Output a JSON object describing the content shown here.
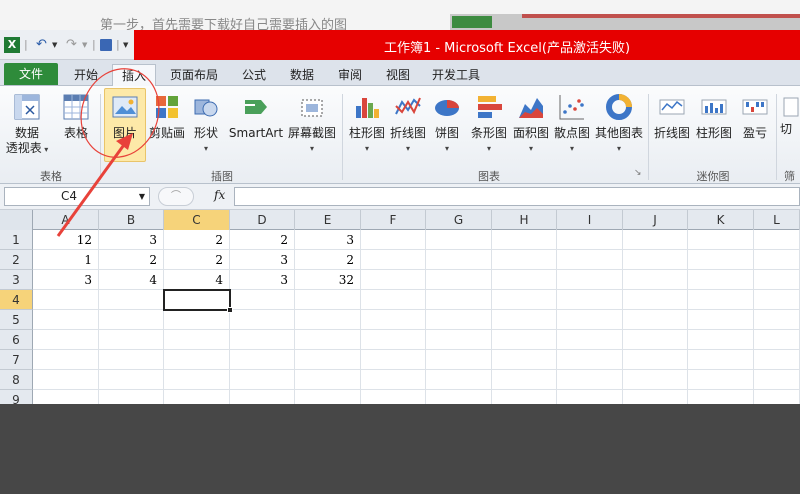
{
  "background": {
    "doc_text": "第一步，首先需要下载好自己需要插入的图"
  },
  "window": {
    "title": "工作簿1 - Microsoft Excel(产品激活失败)"
  },
  "tabs": [
    "文件",
    "开始",
    "插入",
    "页面布局",
    "公式",
    "数据",
    "审阅",
    "视图",
    "开发工具"
  ],
  "active_tab": "插入",
  "ribbon": {
    "groups": {
      "tables": "表格",
      "illustrations": "插图",
      "charts": "图表",
      "sparklines": "迷你图",
      "filter": "筛"
    },
    "buttons": {
      "pivot_line1": "数据",
      "pivot_line2": "透视表",
      "table": "表格",
      "picture": "图片",
      "clipart": "剪贴画",
      "shapes": "形状",
      "smartart": "SmartArt",
      "screenshot": "屏幕截图",
      "column_chart": "柱形图",
      "line_chart": "折线图",
      "pie_chart": "饼图",
      "bar_chart": "条形图",
      "area_chart": "面积图",
      "scatter_chart": "散点图",
      "other_charts": "其他图表",
      "spark_line": "折线图",
      "spark_column": "柱形图",
      "spark_winloss": "盈亏",
      "slicer": "切"
    }
  },
  "formula_bar": {
    "name_box": "C4",
    "fx": "fx",
    "formula": ""
  },
  "columns": [
    "A",
    "B",
    "C",
    "D",
    "E",
    "F",
    "G",
    "H",
    "I",
    "J",
    "K",
    "L"
  ],
  "selected_column": "C",
  "rows": [
    "1",
    "2",
    "3",
    "4",
    "5",
    "6",
    "7",
    "8",
    "9"
  ],
  "selected_row": "4",
  "cells": [
    [
      "12",
      "3",
      "2",
      "2",
      "3"
    ],
    [
      "1",
      "2",
      "2",
      "3",
      "2"
    ],
    [
      "3",
      "4",
      "4",
      "3",
      "32"
    ]
  ],
  "colors": {
    "title_red": "#e60000",
    "file_tab_green": "#2e8b3a",
    "annotation_red": "#e8423a",
    "selection_yellow": "#f6d37a"
  }
}
